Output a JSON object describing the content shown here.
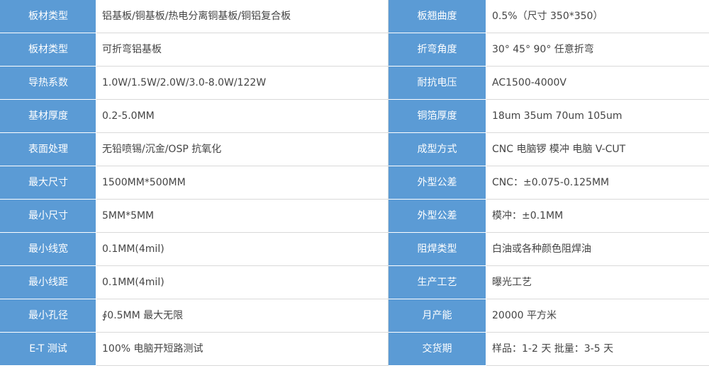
{
  "colors": {
    "label_bg": "#5b9bd5",
    "label_text": "#ffffff",
    "value_text": "#444444",
    "border": "#d9d9d9"
  },
  "rows": [
    {
      "label1": "板材类型",
      "value1": "铝基板/铜基板/热电分离铜基板/铜铝复合板",
      "label2": "板翘曲度",
      "value2": "0.5%（尺寸 350*350）"
    },
    {
      "label1": "板材类型",
      "value1": "可折弯铝基板",
      "label2": "折弯角度",
      "value2": "30° 45° 90° 任意折弯"
    },
    {
      "label1": "导热系数",
      "value1": "1.0W/1.5W/2.0W/3.0-8.0W/122W",
      "label2": "耐抗电压",
      "value2": "AC1500-4000V"
    },
    {
      "label1": "基材厚度",
      "value1": "0.2-5.0MM",
      "label2": "铜箔厚度",
      "value2": "18um 35um 70um 105um"
    },
    {
      "label1": "表面处理",
      "value1": "无铅喷锡/沉金/OSP 抗氧化",
      "label2": "成型方式",
      "value2": "CNC 电脑锣 模冲 电脑 V-CUT"
    },
    {
      "label1": "最大尺寸",
      "value1": "1500MM*500MM",
      "label2": "外型公差",
      "value2": "CNC：±0.075-0.125MM"
    },
    {
      "label1": "最小尺寸",
      "value1": "5MM*5MM",
      "label2": "外型公差",
      "value2": "模冲：±0.1MM"
    },
    {
      "label1": "最小线宽",
      "value1": "0.1MM(4mil)",
      "label2": "阻焊类型",
      "value2": "白油或各种颜色阻焊油"
    },
    {
      "label1": "最小线距",
      "value1": "0.1MM(4mil)",
      "label2": "生产工艺",
      "value2": "曝光工艺"
    },
    {
      "label1": "最小孔径",
      "value1": "∮0.5MM 最大无限",
      "label2": "月产能",
      "value2": "20000 平方米"
    },
    {
      "label1": "E-T 测试",
      "value1": "100% 电脑开短路测试",
      "label2": "交货期",
      "value2": "样品：1-2 天 批量：3-5 天"
    }
  ]
}
